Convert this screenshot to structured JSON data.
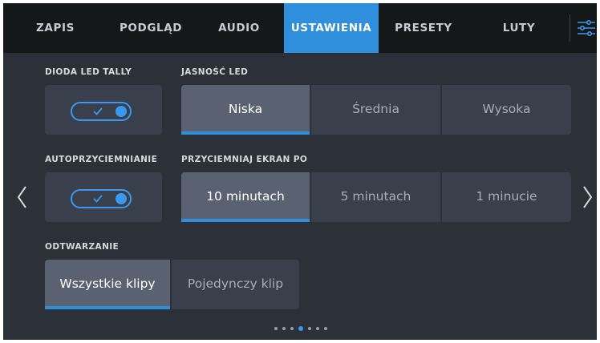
{
  "tabs": [
    {
      "label": "ZAPIS",
      "active": false
    },
    {
      "label": "PODGLĄD",
      "active": false
    },
    {
      "label": "AUDIO",
      "active": false
    },
    {
      "label": "USTAWIENIA",
      "active": true
    },
    {
      "label": "PRESETY",
      "active": false
    },
    {
      "label": "LUTY",
      "active": false
    }
  ],
  "settings": {
    "tally": {
      "label": "DIODA LED TALLY",
      "on": true
    },
    "led_brightness": {
      "label": "JASNOŚĆ LED",
      "options": [
        "Niska",
        "Średnia",
        "Wysoka"
      ],
      "selected": "Niska"
    },
    "auto_dim": {
      "label": "AUTOPRZYCIEMNIANIE",
      "on": true
    },
    "dim_after": {
      "label": "PRZYCIEMNIAJ EKRAN PO",
      "options": [
        "10 minutach",
        "5 minutach",
        "1 minucie"
      ],
      "selected": "10 minutach"
    },
    "playback": {
      "label": "ODTWARZANIE",
      "options": [
        "Wszystkie klipy",
        "Pojedynczy klip"
      ],
      "selected": "Wszystkie klipy"
    }
  },
  "pagination": {
    "pages": 7,
    "current": 4
  },
  "colors": {
    "accent": "#2f8fdd",
    "background": "#2b3039",
    "tab_bar": "#151819",
    "control": "#3a404b",
    "selected": "#5a6272"
  }
}
